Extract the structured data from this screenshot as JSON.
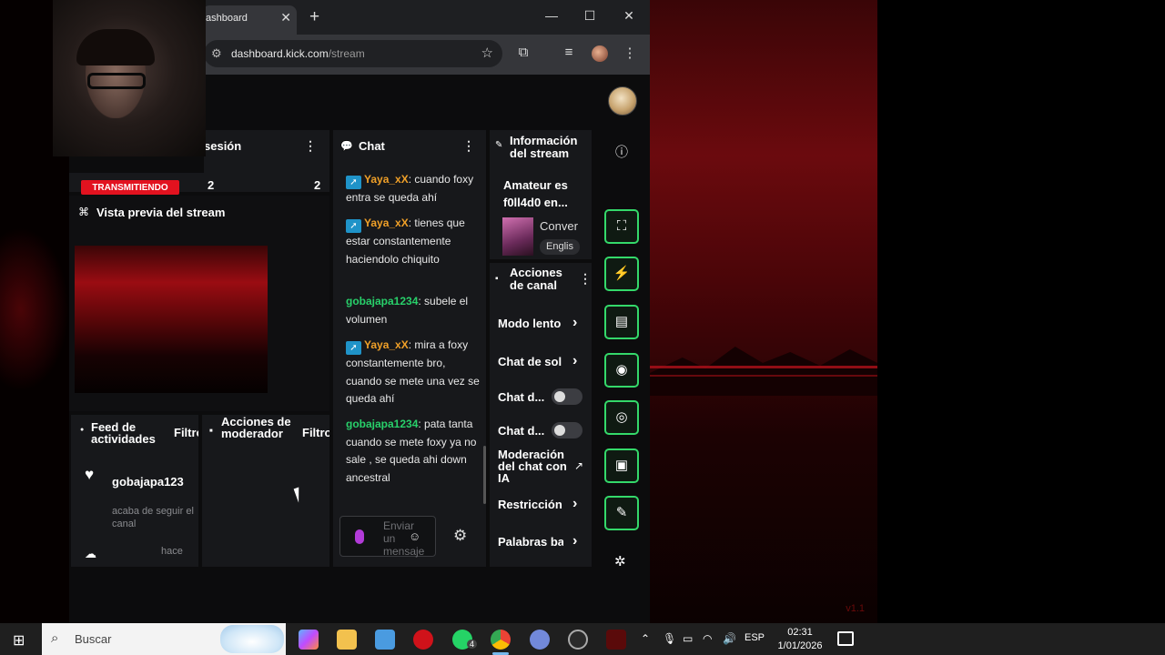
{
  "browser": {
    "tab_title": "ashboard",
    "tab_close": "✕",
    "new_tab": "+",
    "win_min": "—",
    "win_max": "☐",
    "win_close": "✕",
    "url_host": "dashboard.kick.com",
    "url_path": "/stream"
  },
  "session_panel": {
    "title": "sesión",
    "live_badge": "TRANSMITIENDO",
    "stat_1": "2",
    "stat_2": "2"
  },
  "preview_panel": {
    "title": "Vista previa del stream"
  },
  "chat": {
    "title": "Chat",
    "messages": [
      {
        "user": "Yaya_xX",
        "text": ": cuando foxy entra se queda ahí"
      },
      {
        "user": "Yaya_xX",
        "text": ": tienes que estar constantemente haciendolo chiquito"
      },
      {
        "user": "gobajapa1234",
        "text": ": subele el volumen"
      },
      {
        "user": "Yaya_xX",
        "text": ": mira a foxy constantemente bro, cuando se mete una vez se queda ahí"
      },
      {
        "user": "gobajapa1234",
        "text": ": pata tanta cuando se mete foxy ya no sale , se queda ahi down ancestral"
      }
    ],
    "input_placeholder": "Enviar un mensaje"
  },
  "stream_info": {
    "title": "Información del stream",
    "stream_title": "Amateur es f0ll4d0 en...",
    "category": "Conver",
    "language": "Englis"
  },
  "channel_actions": {
    "title": "Acciones de canal",
    "items": [
      {
        "label": "Modo lento"
      },
      {
        "label": "Chat de sol"
      },
      {
        "label": "Chat d..."
      },
      {
        "label": "Chat d..."
      },
      {
        "label": "Moderación del chat con IA"
      },
      {
        "label": "Restricción"
      },
      {
        "label": "Palabras ba"
      }
    ]
  },
  "activity_feed": {
    "title": "Feed de actividades",
    "filter": "Filtro",
    "user": "gobajapa123",
    "event": "acaba de seguir el canal",
    "time": "hace"
  },
  "mod_actions": {
    "title": "Acciones de moderador",
    "filter": "Filtro"
  },
  "sidebar_tools": {
    "icons": [
      "fullscreen-icon",
      "lightning-icon",
      "notes-icon",
      "chat-bubble-icon",
      "broadcast-icon",
      "layout-icon",
      "wrench-icon",
      "share-icon"
    ]
  },
  "taskbar": {
    "search_placeholder": "Buscar",
    "lang": "ESP",
    "time": "02:31",
    "date": "1/01/2026",
    "whatsapp_badge": "4"
  },
  "game": {
    "version": "v1.1"
  },
  "colors": {
    "accent_green": "#34d96a",
    "live_red": "#e2121f",
    "username_orange": "#f0a028",
    "username_green": "#28d06a"
  }
}
